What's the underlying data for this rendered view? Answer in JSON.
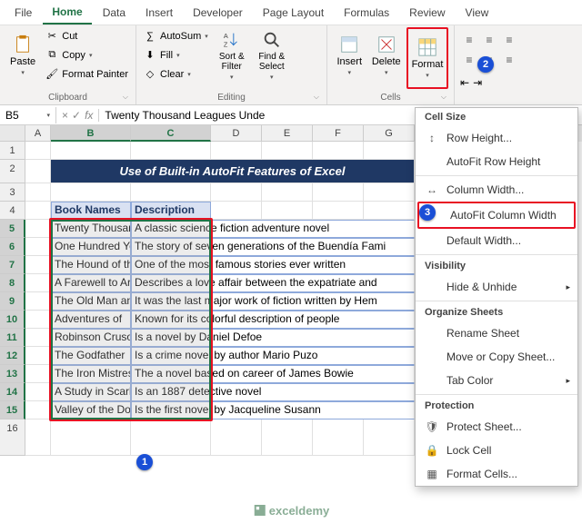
{
  "tabs": [
    "File",
    "Home",
    "Data",
    "Insert",
    "Developer",
    "Page Layout",
    "Formulas",
    "Review",
    "View"
  ],
  "active_tab": 1,
  "clipboard": {
    "paste": "Paste",
    "cut": "Cut",
    "copy": "Copy",
    "painter": "Format Painter",
    "label": "Clipboard"
  },
  "editing": {
    "autosum": "AutoSum",
    "fill": "Fill",
    "clear": "Clear",
    "sort": "Sort & Filter",
    "find": "Find & Select",
    "label": "Editing"
  },
  "cells": {
    "insert": "Insert",
    "delete": "Delete",
    "format": "Format",
    "label": "Cells"
  },
  "namebox": "B5",
  "formula": "Twenty Thousand Leagues Unde",
  "cols": {
    "A": 28,
    "B": 88,
    "C": 88,
    "D": 56,
    "E": 56,
    "F": 56,
    "G": 56
  },
  "title": "Use of Built-in AutoFit Features of Excel",
  "headers": {
    "b": "Book Names",
    "c": "Description"
  },
  "rows": [
    {
      "b": "Twenty Thousand Leagues",
      "c": "A classic science fiction adventure novel"
    },
    {
      "b": "One Hundred Years",
      "c": "The story of seven generations of the Buendía Fami"
    },
    {
      "b": "The Hound of the",
      "c": "One of the most famous stories ever written"
    },
    {
      "b": "A Farewell to Arms",
      "c": "Describes a love affair between the expatriate and"
    },
    {
      "b": "The Old Man and",
      "c": "It was the last major work of fiction written by Hem"
    },
    {
      "b": "Adventures of",
      "c": "Known for its colorful description of people"
    },
    {
      "b": "Robinson Crusoe",
      "c": "Is a novel by Daniel Defoe"
    },
    {
      "b": "The Godfather",
      "c": "Is a crime novel by author Mario Puzo"
    },
    {
      "b": "The Iron Mistress",
      "c": "The a novel based on career of James Bowie"
    },
    {
      "b": "A Study in Scarlet",
      "c": "Is an 1887 detective novel"
    },
    {
      "b": "Valley of the Dolls",
      "c": "Is the first novel by Jacqueline Susann"
    }
  ],
  "dropdown": {
    "s1": "Cell Size",
    "rowh": "Row Height...",
    "afrh": "AutoFit Row Height",
    "colw": "Column Width...",
    "afcw": "AutoFit Column Width",
    "defw": "Default Width...",
    "s2": "Visibility",
    "hide": "Hide & Unhide",
    "s3": "Organize Sheets",
    "rename": "Rename Sheet",
    "move": "Move or Copy Sheet...",
    "tabc": "Tab Color",
    "s4": "Protection",
    "prot": "Protect Sheet...",
    "lock": "Lock Cell",
    "fmt": "Format Cells..."
  },
  "watermark": "exceldemy"
}
